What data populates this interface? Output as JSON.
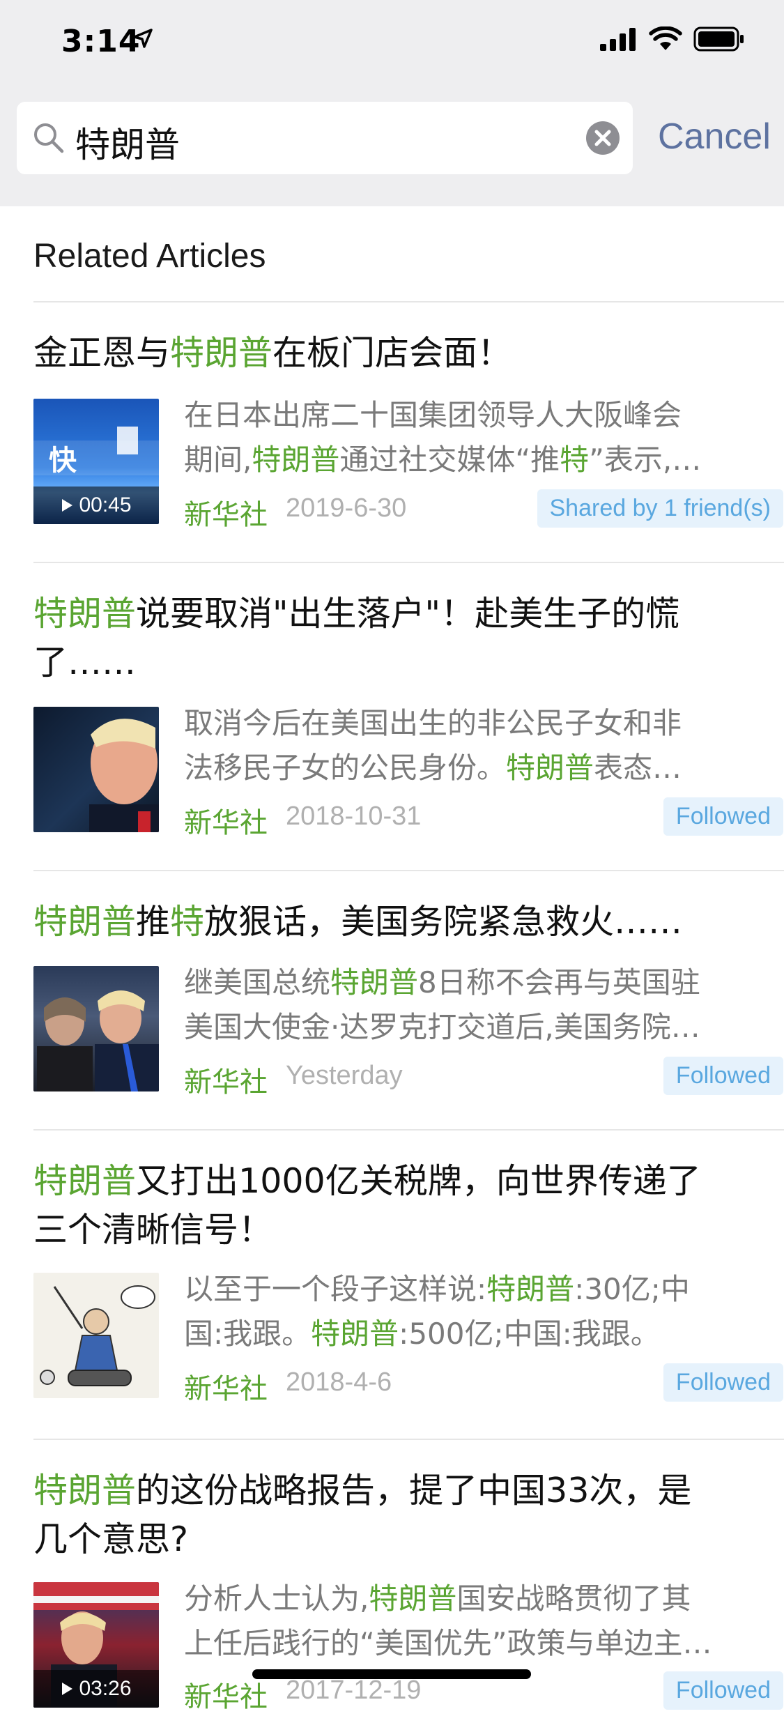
{
  "status_bar": {
    "time": "3:14"
  },
  "search": {
    "query": "特朗普",
    "cancel_label": "Cancel"
  },
  "section": {
    "title": "Related Articles"
  },
  "articles": [
    {
      "title_parts": [
        "金正恩与",
        "特朗普",
        "在板门店会面！"
      ],
      "snippet_line1_parts": [
        "在日本出席二十国集团领导人大阪峰会"
      ],
      "snippet_line2_parts": [
        "期间,",
        "特朗普",
        "通过社交媒体“推",
        "特",
        "”表示,…"
      ],
      "source": "新华社",
      "date": "2019-6-30",
      "badge": "Shared by 1 friend(s)",
      "video_duration": "00:45",
      "thumb_text": "快"
    },
    {
      "title_line1_parts": [
        "特朗普",
        "说要取消\"出生落户\"！赴美生子的慌"
      ],
      "title_line2": "了……",
      "snippet_line1_parts": [
        "取消今后在美国出生的非公民子女和非"
      ],
      "snippet_line2_parts": [
        "法移民子女的公民身份。",
        "特朗普",
        "表态…"
      ],
      "source": "新华社",
      "date": "2018-10-31",
      "badge": "Followed"
    },
    {
      "title_parts": [
        "特朗普",
        "推",
        "特",
        "放狠话，美国务院紧急救火……"
      ],
      "snippet_line1_parts": [
        "继美国总统",
        "特朗普",
        "8日称不会再与英国驻"
      ],
      "snippet_line2_parts": [
        "美国大使金·达罗克打交道后,美国务院…"
      ],
      "source": "新华社",
      "date": "Yesterday",
      "badge": "Followed"
    },
    {
      "title_line1_parts": [
        "特朗普",
        "又打出1000亿关税牌，向世界传递了"
      ],
      "title_line2": "三个清晰信号！",
      "snippet_line1_parts": [
        "以至于一个段子这样说:",
        "特朗普",
        ":30亿;中"
      ],
      "snippet_line2_parts": [
        "国:我跟。",
        "特朗普",
        ":500亿;中国:我跟。"
      ],
      "source": "新华社",
      "date": "2018-4-6",
      "badge": "Followed"
    },
    {
      "title_line1_parts": [
        "特朗普",
        "的这份战略报告，提了中国33次，是"
      ],
      "title_line2": "几个意思?",
      "snippet_line1_parts": [
        "分析人士认为,",
        "特朗普",
        "国安战略贯彻了其"
      ],
      "snippet_line2_parts": [
        "上任后践行的“美国优先”政策与单边主…"
      ],
      "source": "新华社",
      "date": "2017-12-19",
      "badge": "Followed",
      "video_duration": "03:26"
    }
  ],
  "colors": {
    "highlight": "#5aa532",
    "badge_bg": "#e6f2fc",
    "badge_text": "#59a7df",
    "cancel": "#5d72a0"
  }
}
